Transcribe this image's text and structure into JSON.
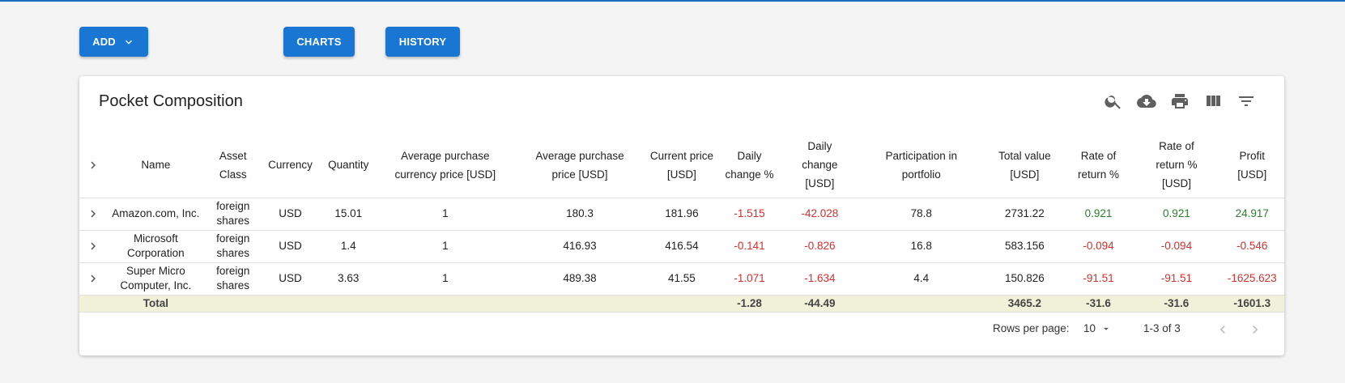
{
  "colors": {
    "accent": "#1976d2",
    "negative": "#d32f2f",
    "positive": "#2e7d32",
    "total_row_bg": "#f1f1da"
  },
  "toolbar": {
    "add_label": "ADD",
    "charts_label": "CHARTS",
    "history_label": "HISTORY"
  },
  "card": {
    "title": "Pocket Composition",
    "icons": [
      "search-icon",
      "cloud-download-icon",
      "print-icon",
      "view-columns-icon",
      "filter-icon"
    ]
  },
  "table": {
    "columns": [
      "",
      "Name",
      "Asset Class",
      "Currency",
      "Quantity",
      "Average purchase currency price [USD]",
      "Average purchase price [USD]",
      "Current price [USD]",
      "Daily change %",
      "Daily change [USD]",
      "Participation in portfolio",
      "Total value [USD]",
      "Rate of return %",
      "Rate of return % [USD]",
      "Profit [USD]"
    ],
    "rows": [
      [
        "",
        "Amazon.com, Inc.",
        "foreign shares",
        "USD",
        "15.01",
        "1",
        "180.3",
        "181.96",
        "-1.515",
        "-42.028",
        "78.8",
        "2731.22",
        "0.921",
        "0.921",
        "24.917"
      ],
      [
        "",
        "Microsoft Corporation",
        "foreign shares",
        "USD",
        "1.4",
        "1",
        "416.93",
        "416.54",
        "-0.141",
        "-0.826",
        "16.8",
        "583.156",
        "-0.094",
        "-0.094",
        "-0.546"
      ],
      [
        "",
        "Super Micro Computer, Inc.",
        "foreign shares",
        "USD",
        "3.63",
        "1",
        "489.38",
        "41.55",
        "-1.071",
        "-1.634",
        "4.4",
        "150.826",
        "-91.51",
        "-91.51",
        "-1625.623"
      ]
    ],
    "total": [
      "",
      "Total",
      "",
      "",
      "",
      "",
      "",
      "",
      "-1.28",
      "-44.49",
      "",
      "3465.2",
      "-31.6",
      "-31.6",
      "-1601.3"
    ]
  },
  "pagination": {
    "rows_per_page_label": "Rows per page:",
    "rows_per_page_value": "10",
    "range": "1-3 of 3"
  }
}
